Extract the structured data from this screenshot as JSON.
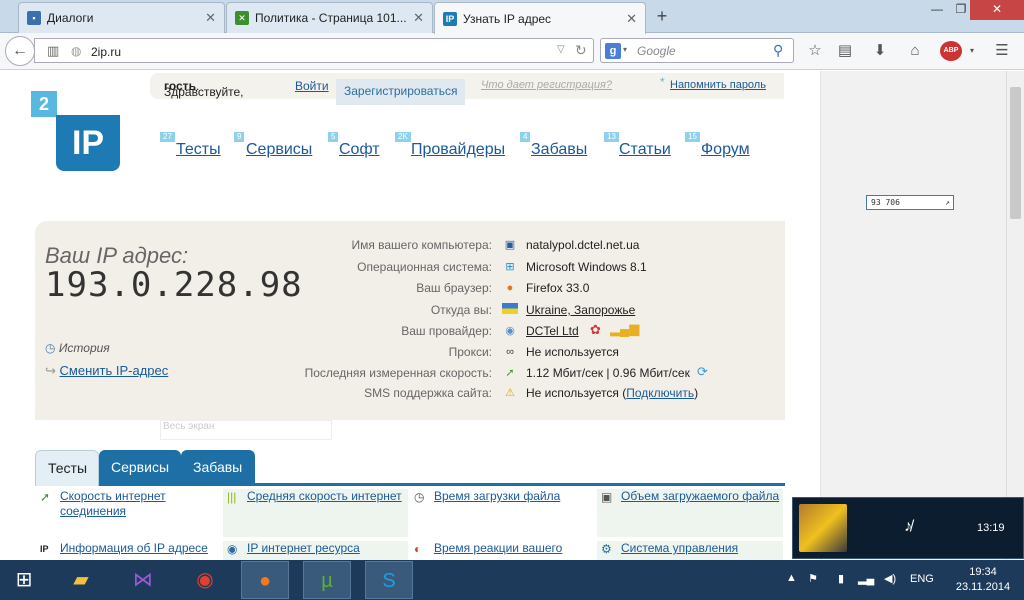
{
  "browser": {
    "tabs": [
      {
        "label": "Диалоги",
        "icon": "chat-icon",
        "color": "#3a6fb0"
      },
      {
        "label": "Политика - Страница 101...",
        "icon": "xbox-icon",
        "color": "#3e8e2f"
      },
      {
        "label": "Узнать IP адрес",
        "icon": "ip-icon",
        "color": "#1d7ab2"
      }
    ],
    "url": "2ip.ru",
    "search_placeholder": "Google"
  },
  "site": {
    "greeting_prefix": "Здравствуйте,",
    "greeting_user": "гость",
    "login": "Войти",
    "register": "Зарегистрироваться",
    "why_register": "Что дает регистрация?",
    "remind_password": "Напомнить пароль",
    "logo_small": "2",
    "logo_big": "IP",
    "menu": [
      {
        "label": "Тесты",
        "badge": "27"
      },
      {
        "label": "Сервисы",
        "badge": "9"
      },
      {
        "label": "Софт",
        "badge": "5"
      },
      {
        "label": "Провайдеры",
        "badge": "2K"
      },
      {
        "label": "Забавы",
        "badge": "4"
      },
      {
        "label": "Статьи",
        "badge": "13"
      },
      {
        "label": "Форум",
        "badge": "15"
      }
    ],
    "counter": "93 706"
  },
  "ip_box": {
    "label": "Ваш IP адрес:",
    "ip": "193.0.228.98",
    "history": "История",
    "change_ip": "Сменить IP-адрес",
    "rows": [
      {
        "label": "Имя вашего компьютера:",
        "value": "natalypol.dctel.net.ua",
        "icon": "computer-icon"
      },
      {
        "label": "Операционная система:",
        "value": "Microsoft Windows 8.1",
        "icon": "windows-icon"
      },
      {
        "label": "Ваш браузер:",
        "value": "Firefox 33.0",
        "icon": "firefox-icon"
      },
      {
        "label": "Откуда вы:",
        "value": "Ukraine, Запорожье",
        "icon": "flag-icon"
      },
      {
        "label": "Ваш провайдер:",
        "value": "DCTel Ltd",
        "icon": "provider-icon"
      },
      {
        "label": "Прокси:",
        "value": "Не используется",
        "icon": "proxy-icon"
      },
      {
        "label": "Последняя измеренная скорость:",
        "value": "1.12 Мбит/сек | 0.96 Мбит/сек",
        "icon": "speed-icon"
      },
      {
        "label": "SMS поддержка сайта:",
        "value_prefix": "Не используется (",
        "value_link": "Подключить",
        "value_suffix": ")",
        "icon": "warning-icon"
      }
    ]
  },
  "bottom_tabs": [
    "Тесты",
    "Сервисы",
    "Забавы"
  ],
  "tools": [
    "Скорость интернет соединения",
    "Средняя скорость интернет",
    "Время загрузки файла",
    "Объем загружаемого файла",
    "Информация об IP адресе",
    "IP интернет ресурса",
    "Время реакции вашего",
    "Система управления"
  ],
  "watermark": "Весь экран",
  "media": {
    "time": "13:19"
  },
  "taskbar": {
    "lang": "ENG",
    "time": "19:34",
    "date": "23.11.2014"
  }
}
